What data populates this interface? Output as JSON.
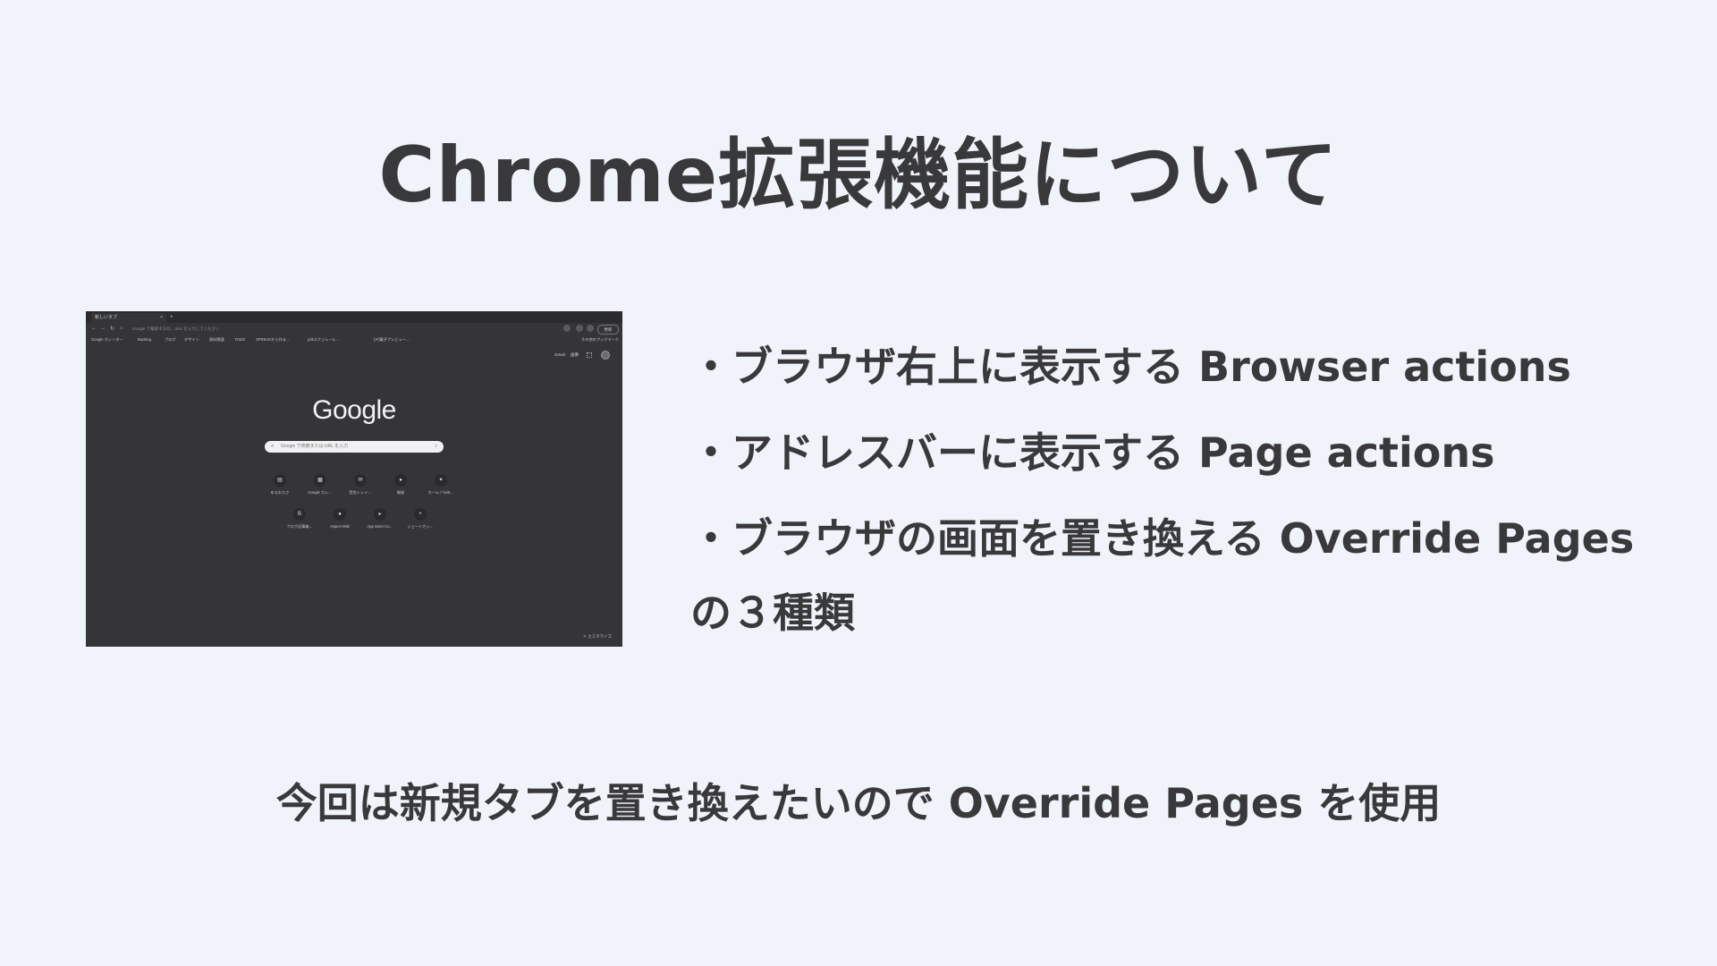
{
  "slide": {
    "title": "Chrome拡張機能について",
    "bullets": [
      "・ブラウザ右上に表示する Browser actions",
      "・アドレスバーに表示する Page actions",
      "・ブラウザの画面を置き換える Override Pages"
    ],
    "summary": "の３種類",
    "conclusion": "今回は新規タブを置き換えたいので Override Pages を使用"
  },
  "screenshot": {
    "tab_title": "新しいタブ",
    "tab_close": "×",
    "tab_plus": "+",
    "omnibox_text": "Google で検索するか、URL を入力してください",
    "profile_label": "更新",
    "bookmarks": [
      "Google カレンダー",
      "Backlog",
      "ブログ",
      "デザイン",
      "資料関連",
      "TODO",
      "SPREADから作る…",
      "p4kスケジュール…",
      "[デ]電子プレビュー…"
    ],
    "bookmarks_right": "その他のブックマーク",
    "gbar": [
      "Gmail",
      "画像"
    ],
    "google_logo": "Google",
    "search_placeholder": "Google で検索または URL を入力",
    "shortcuts_row1": [
      "ゆるおたさ",
      "Google カレ…",
      "受信トレイ…",
      "開発",
      "ホーム / Twitt…"
    ],
    "shortcuts_row2": [
      "ブログ記事編…",
      "Aspect Wiki",
      "App Store Co…",
      "ショートカッ…"
    ],
    "customize_label": "カスタマイズ"
  }
}
